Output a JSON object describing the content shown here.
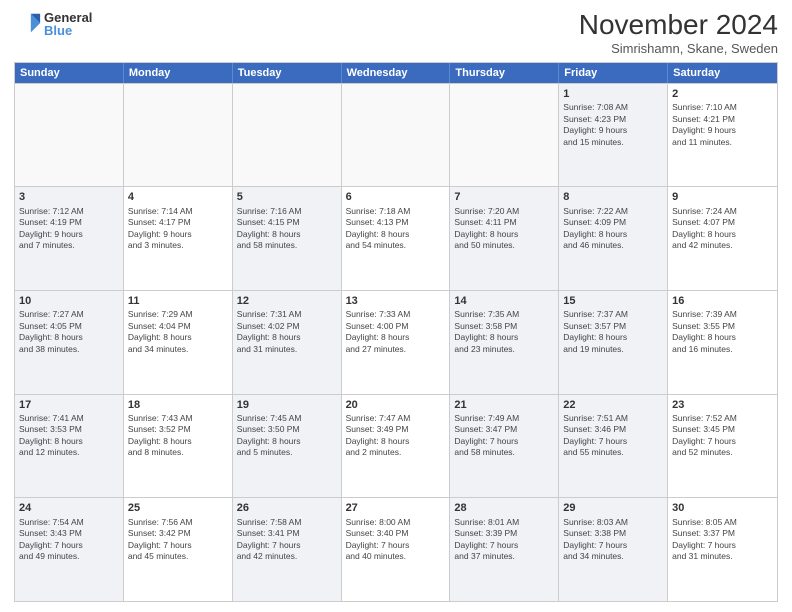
{
  "logo": {
    "line1": "General",
    "line2": "Blue"
  },
  "title": "November 2024",
  "location": "Simrishamn, Skane, Sweden",
  "days_of_week": [
    "Sunday",
    "Monday",
    "Tuesday",
    "Wednesday",
    "Thursday",
    "Friday",
    "Saturday"
  ],
  "weeks": [
    [
      {
        "day": "",
        "detail": "",
        "empty": true
      },
      {
        "day": "",
        "detail": "",
        "empty": true
      },
      {
        "day": "",
        "detail": "",
        "empty": true
      },
      {
        "day": "",
        "detail": "",
        "empty": true
      },
      {
        "day": "",
        "detail": "",
        "empty": true
      },
      {
        "day": "1",
        "detail": "Sunrise: 7:08 AM\nSunset: 4:23 PM\nDaylight: 9 hours\nand 15 minutes.",
        "shaded": true
      },
      {
        "day": "2",
        "detail": "Sunrise: 7:10 AM\nSunset: 4:21 PM\nDaylight: 9 hours\nand 11 minutes.",
        "shaded": false
      }
    ],
    [
      {
        "day": "3",
        "detail": "Sunrise: 7:12 AM\nSunset: 4:19 PM\nDaylight: 9 hours\nand 7 minutes.",
        "shaded": true
      },
      {
        "day": "4",
        "detail": "Sunrise: 7:14 AM\nSunset: 4:17 PM\nDaylight: 9 hours\nand 3 minutes.",
        "shaded": false
      },
      {
        "day": "5",
        "detail": "Sunrise: 7:16 AM\nSunset: 4:15 PM\nDaylight: 8 hours\nand 58 minutes.",
        "shaded": true
      },
      {
        "day": "6",
        "detail": "Sunrise: 7:18 AM\nSunset: 4:13 PM\nDaylight: 8 hours\nand 54 minutes.",
        "shaded": false
      },
      {
        "day": "7",
        "detail": "Sunrise: 7:20 AM\nSunset: 4:11 PM\nDaylight: 8 hours\nand 50 minutes.",
        "shaded": true
      },
      {
        "day": "8",
        "detail": "Sunrise: 7:22 AM\nSunset: 4:09 PM\nDaylight: 8 hours\nand 46 minutes.",
        "shaded": true
      },
      {
        "day": "9",
        "detail": "Sunrise: 7:24 AM\nSunset: 4:07 PM\nDaylight: 8 hours\nand 42 minutes.",
        "shaded": false
      }
    ],
    [
      {
        "day": "10",
        "detail": "Sunrise: 7:27 AM\nSunset: 4:05 PM\nDaylight: 8 hours\nand 38 minutes.",
        "shaded": true
      },
      {
        "day": "11",
        "detail": "Sunrise: 7:29 AM\nSunset: 4:04 PM\nDaylight: 8 hours\nand 34 minutes.",
        "shaded": false
      },
      {
        "day": "12",
        "detail": "Sunrise: 7:31 AM\nSunset: 4:02 PM\nDaylight: 8 hours\nand 31 minutes.",
        "shaded": true
      },
      {
        "day": "13",
        "detail": "Sunrise: 7:33 AM\nSunset: 4:00 PM\nDaylight: 8 hours\nand 27 minutes.",
        "shaded": false
      },
      {
        "day": "14",
        "detail": "Sunrise: 7:35 AM\nSunset: 3:58 PM\nDaylight: 8 hours\nand 23 minutes.",
        "shaded": true
      },
      {
        "day": "15",
        "detail": "Sunrise: 7:37 AM\nSunset: 3:57 PM\nDaylight: 8 hours\nand 19 minutes.",
        "shaded": true
      },
      {
        "day": "16",
        "detail": "Sunrise: 7:39 AM\nSunset: 3:55 PM\nDaylight: 8 hours\nand 16 minutes.",
        "shaded": false
      }
    ],
    [
      {
        "day": "17",
        "detail": "Sunrise: 7:41 AM\nSunset: 3:53 PM\nDaylight: 8 hours\nand 12 minutes.",
        "shaded": true
      },
      {
        "day": "18",
        "detail": "Sunrise: 7:43 AM\nSunset: 3:52 PM\nDaylight: 8 hours\nand 8 minutes.",
        "shaded": false
      },
      {
        "day": "19",
        "detail": "Sunrise: 7:45 AM\nSunset: 3:50 PM\nDaylight: 8 hours\nand 5 minutes.",
        "shaded": true
      },
      {
        "day": "20",
        "detail": "Sunrise: 7:47 AM\nSunset: 3:49 PM\nDaylight: 8 hours\nand 2 minutes.",
        "shaded": false
      },
      {
        "day": "21",
        "detail": "Sunrise: 7:49 AM\nSunset: 3:47 PM\nDaylight: 7 hours\nand 58 minutes.",
        "shaded": true
      },
      {
        "day": "22",
        "detail": "Sunrise: 7:51 AM\nSunset: 3:46 PM\nDaylight: 7 hours\nand 55 minutes.",
        "shaded": true
      },
      {
        "day": "23",
        "detail": "Sunrise: 7:52 AM\nSunset: 3:45 PM\nDaylight: 7 hours\nand 52 minutes.",
        "shaded": false
      }
    ],
    [
      {
        "day": "24",
        "detail": "Sunrise: 7:54 AM\nSunset: 3:43 PM\nDaylight: 7 hours\nand 49 minutes.",
        "shaded": true
      },
      {
        "day": "25",
        "detail": "Sunrise: 7:56 AM\nSunset: 3:42 PM\nDaylight: 7 hours\nand 45 minutes.",
        "shaded": false
      },
      {
        "day": "26",
        "detail": "Sunrise: 7:58 AM\nSunset: 3:41 PM\nDaylight: 7 hours\nand 42 minutes.",
        "shaded": true
      },
      {
        "day": "27",
        "detail": "Sunrise: 8:00 AM\nSunset: 3:40 PM\nDaylight: 7 hours\nand 40 minutes.",
        "shaded": false
      },
      {
        "day": "28",
        "detail": "Sunrise: 8:01 AM\nSunset: 3:39 PM\nDaylight: 7 hours\nand 37 minutes.",
        "shaded": true
      },
      {
        "day": "29",
        "detail": "Sunrise: 8:03 AM\nSunset: 3:38 PM\nDaylight: 7 hours\nand 34 minutes.",
        "shaded": true
      },
      {
        "day": "30",
        "detail": "Sunrise: 8:05 AM\nSunset: 3:37 PM\nDaylight: 7 hours\nand 31 minutes.",
        "shaded": false
      }
    ]
  ]
}
